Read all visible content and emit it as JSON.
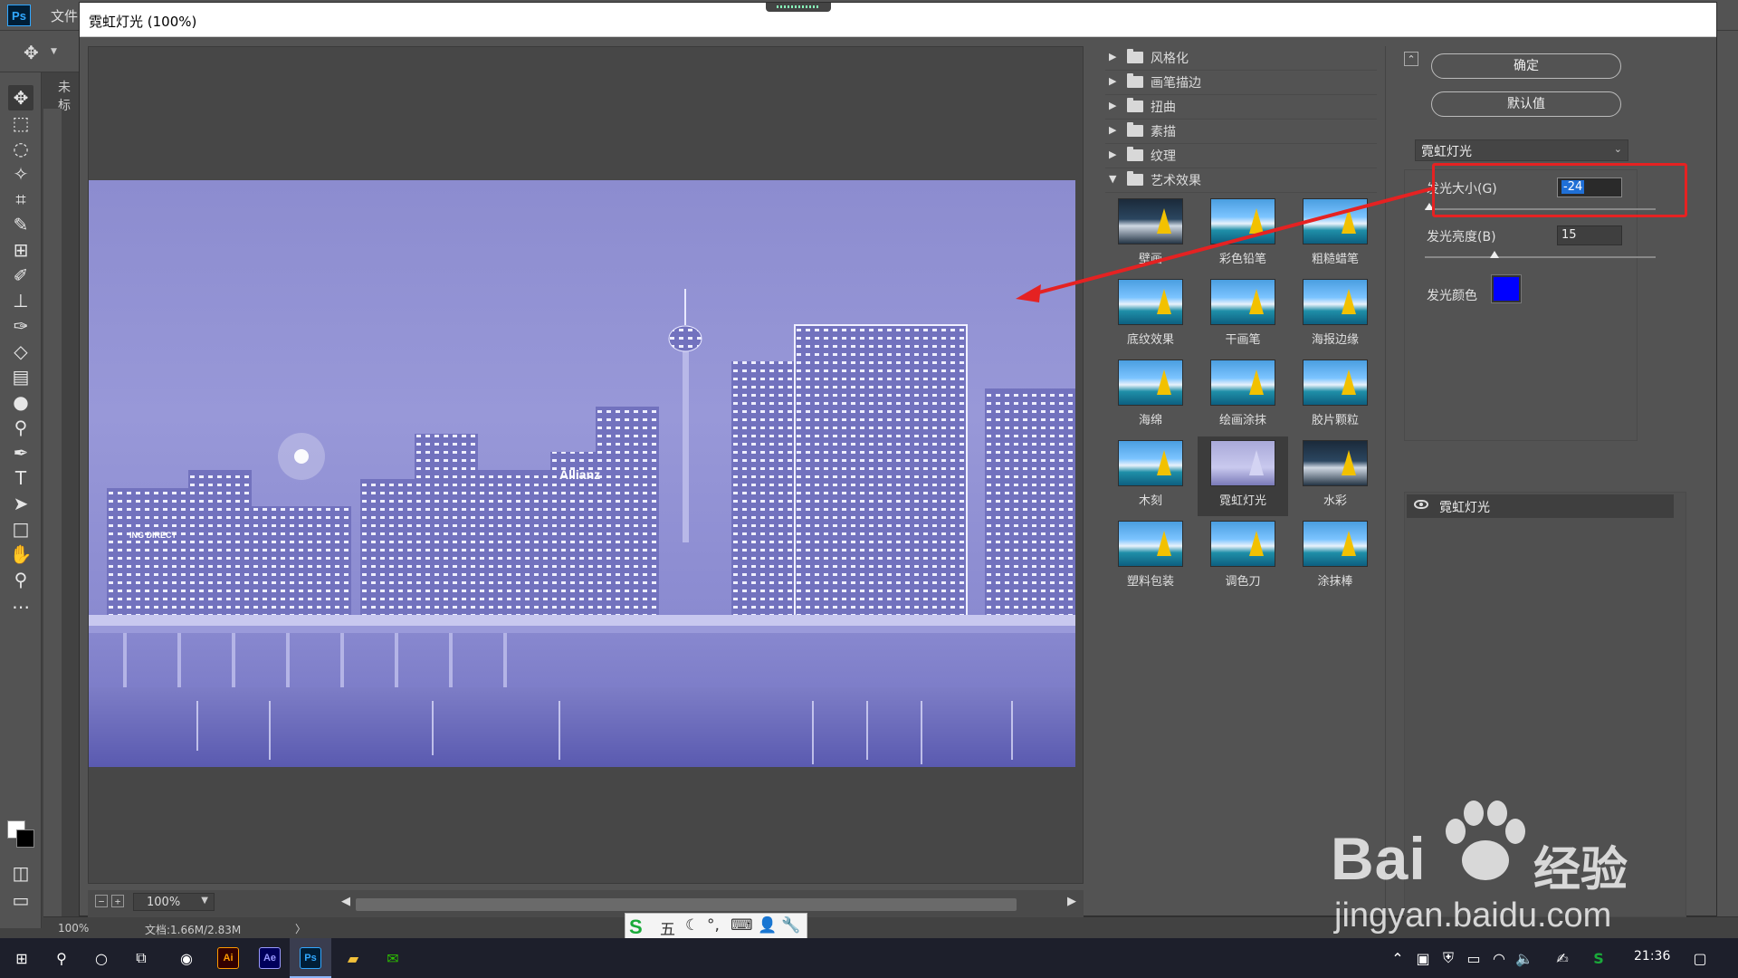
{
  "app": {
    "logo": "Ps",
    "menu_file": "文件",
    "doc_tab": "未标",
    "status_zoom": "100%",
    "status_doc": "文档:1.66M/2.83M",
    "status_arrow": "〉"
  },
  "dialog": {
    "title": "霓虹灯光 (100%)",
    "zoom_value": "100%",
    "zoom_minus": "−",
    "zoom_plus": "+"
  },
  "gallery": {
    "categories": [
      {
        "label": "风格化",
        "arrow": "▶"
      },
      {
        "label": "画笔描边",
        "arrow": "▶"
      },
      {
        "label": "扭曲",
        "arrow": "▶"
      },
      {
        "label": "素描",
        "arrow": "▶"
      },
      {
        "label": "纹理",
        "arrow": "▶"
      },
      {
        "label": "艺术效果",
        "arrow": "▼"
      }
    ],
    "thumbnails": [
      {
        "label": "壁画"
      },
      {
        "label": "彩色铅笔"
      },
      {
        "label": "粗糙蜡笔"
      },
      {
        "label": "底纹效果"
      },
      {
        "label": "干画笔"
      },
      {
        "label": "海报边缘"
      },
      {
        "label": "海绵"
      },
      {
        "label": "绘画涂抹"
      },
      {
        "label": "胶片颗粒"
      },
      {
        "label": "木刻"
      },
      {
        "label": "霓虹灯光"
      },
      {
        "label": "水彩"
      },
      {
        "label": "塑料包装"
      },
      {
        "label": "调色刀"
      },
      {
        "label": "涂抹棒"
      }
    ],
    "selected": "霓虹灯光"
  },
  "settings": {
    "ok_button": "确定",
    "default_button": "默认值",
    "filter_name": "霓虹灯光",
    "glow_size_label": "发光大小(G)",
    "glow_size_value": "-24",
    "glow_brightness_label": "发光亮度(B)",
    "glow_brightness_value": "15",
    "glow_color_label": "发光颜色",
    "glow_color": "#0000ff",
    "glow_size_level": 0.02,
    "glow_brightness_level": 0.3,
    "effect_layer_name": "霓虹灯光"
  },
  "taskbar": {
    "clock": "21:36",
    "apps": [
      "Ai",
      "Ae",
      "Ps"
    ]
  },
  "ime": {
    "logo": "S",
    "mode": "五",
    "items": [
      "☾",
      "°,",
      "⌨",
      "👤",
      "🔧"
    ]
  },
  "colors": {
    "accent_red": "#e52222",
    "ps_blue": "#31a8ff",
    "neon_tint": "#8c8ccf"
  },
  "watermark": {
    "brand": "Bai",
    "brand_cn": "经验",
    "url": "jingyan.baidu.com"
  }
}
